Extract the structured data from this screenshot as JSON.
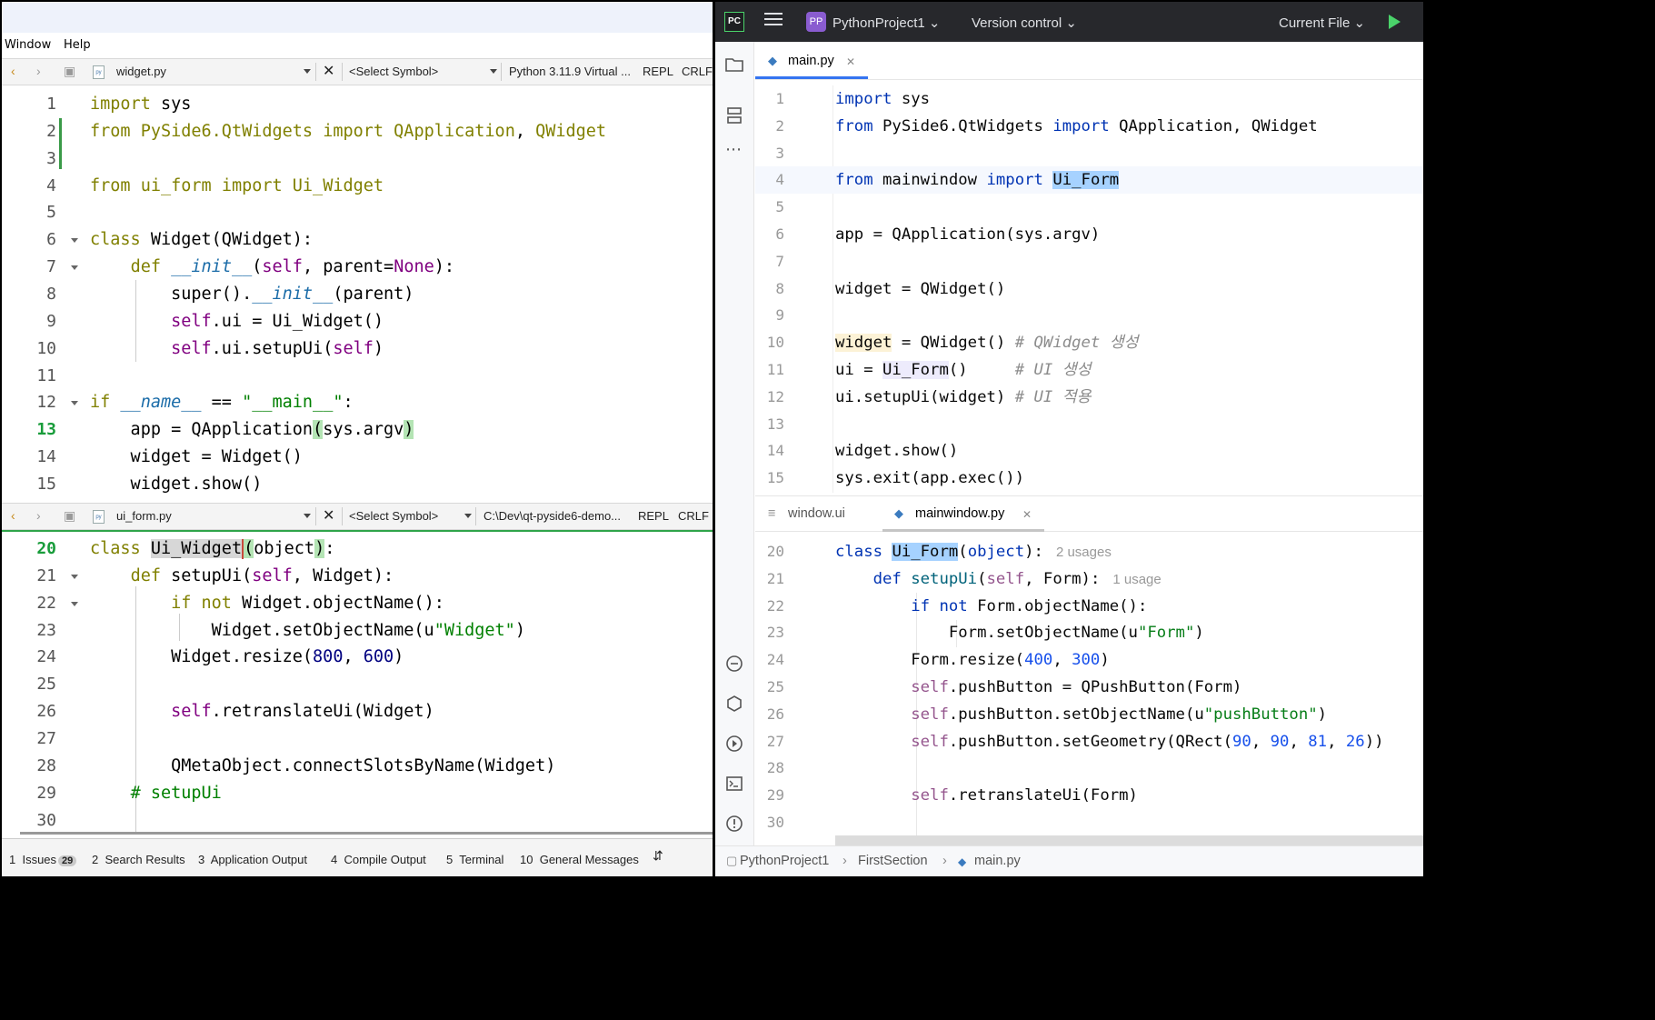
{
  "left": {
    "menu": [
      "Window",
      "Help"
    ],
    "top_toolbar": {
      "file": "widget.py",
      "symbol": "<Select Symbol>",
      "interpreter": "Python 3.11.9 Virtual ...",
      "repl": "REPL",
      "eol": "CRLF"
    },
    "top_code": [
      {
        "n": "1",
        "html": "<span class=\"qk\">import</span> sys"
      },
      {
        "n": "2",
        "html": "<span class=\"qk\">from</span> <span class=\"qk\">PySide6.QtWidgets</span> <span class=\"qk\">import</span> <span class=\"qk\">QApplication</span>, <span class=\"qk\">QWidget</span>"
      },
      {
        "n": "3",
        "html": ""
      },
      {
        "n": "4",
        "html": "<span class=\"qk\">from</span> <span class=\"qk\">ui_form</span> <span class=\"qk\">import</span> <span class=\"qk\">Ui_Widget</span>"
      },
      {
        "n": "5",
        "html": ""
      },
      {
        "n": "6",
        "html": "<span class=\"qk\">class</span> Widget(QWidget):",
        "fold": true
      },
      {
        "n": "7",
        "html": "    <span class=\"qk\">def</span> <span class=\"qf\">__init__</span>(<span class=\"qc\">self</span>, parent=<span class=\"qc\">None</span>):",
        "fold": true
      },
      {
        "n": "8",
        "html": "        super().<span class=\"qf\">__init__</span>(parent)"
      },
      {
        "n": "9",
        "html": "        <span class=\"qc\">self</span>.ui = Ui_Widget()"
      },
      {
        "n": "10",
        "html": "        <span class=\"qc\">self</span>.ui.setupUi(<span class=\"qc\">self</span>)"
      },
      {
        "n": "11",
        "html": ""
      },
      {
        "n": "12",
        "html": "<span class=\"qk\">if</span> <span class=\"qf\">__name__</span> == <span class=\"qs\">\"__main__\"</span>:",
        "fold": true
      },
      {
        "n": "13",
        "html": "    app = QApplication<span class=\"qbr\">(</span>sys.argv<span class=\"qbr\">)</span>",
        "cur": true
      },
      {
        "n": "14",
        "html": "    widget = Widget()"
      },
      {
        "n": "15",
        "html": "    widget.show()"
      }
    ],
    "bottom_toolbar": {
      "file": "ui_form.py",
      "symbol": "<Select Symbol>",
      "path": "C:\\Dev\\qt-pyside6-demo...",
      "repl": "REPL",
      "eol": "CRLF"
    },
    "bottom_code": [
      {
        "n": "20",
        "html": "<span class=\"qk\">class</span> <span class=\"qsel\">Ui_Widget</span><span class=\"qcur\"></span><span class=\"qbr\">(</span>object<span class=\"qbr\">)</span>:",
        "cur": true
      },
      {
        "n": "21",
        "html": "    <span class=\"qk\">def</span> setupUi(<span class=\"qc\">self</span>, Widget):",
        "fold": true
      },
      {
        "n": "22",
        "html": "        <span class=\"qk\">if</span> <span class=\"qk\">not</span> Widget.objectName():",
        "fold": true
      },
      {
        "n": "23",
        "html": "            Widget.setObjectName(u<span class=\"qs\">\"Widget\"</span>)"
      },
      {
        "n": "24",
        "html": "        Widget.resize(<span class=\"qn\">800</span>, <span class=\"qn\">600</span>)"
      },
      {
        "n": "25",
        "html": ""
      },
      {
        "n": "26",
        "html": "        <span class=\"qc\">self</span>.retranslateUi(Widget)"
      },
      {
        "n": "27",
        "html": ""
      },
      {
        "n": "28",
        "html": "        QMetaObject.connectSlotsByName(Widget)"
      },
      {
        "n": "29",
        "html": "    <span class=\"qs\"># setupUi</span>"
      },
      {
        "n": "30",
        "html": ""
      }
    ],
    "output_tabs": [
      {
        "num": "1",
        "label": "Issues",
        "badge": "29"
      },
      {
        "num": "2",
        "label": "Search Results"
      },
      {
        "num": "3",
        "label": "Application Output"
      },
      {
        "num": "4",
        "label": "Compile Output"
      },
      {
        "num": "5",
        "label": "Terminal"
      },
      {
        "num": "10",
        "label": "General Messages"
      }
    ]
  },
  "right": {
    "header": {
      "logo": "PC",
      "project_badge": "PP",
      "project": "PythonProject1",
      "vcs": "Version control",
      "run_config": "Current File"
    },
    "top_tab": "main.py",
    "top_code": [
      {
        "n": "1",
        "html": "<span class=\"pk\">import</span> sys"
      },
      {
        "n": "2",
        "html": "<span class=\"pk\">from</span> PySide6.QtWidgets <span class=\"pk\">import</span> QApplication, QWidget"
      },
      {
        "n": "3",
        "html": ""
      },
      {
        "n": "4",
        "html": "<span class=\"pk\">from</span> mainwindow <span class=\"pk\">import</span> <span class=\"phl\">Ui_Form</span>",
        "cur": true
      },
      {
        "n": "5",
        "html": ""
      },
      {
        "n": "6",
        "html": "app = QApplication(sys.argv)"
      },
      {
        "n": "7",
        "html": ""
      },
      {
        "n": "8",
        "html": "widget = QWidget()"
      },
      {
        "n": "9",
        "html": ""
      },
      {
        "n": "10",
        "html": "<span class=\"pwarn\">widget</span> = QWidget() <span class=\"pcm\"># QWidget 생성</span>"
      },
      {
        "n": "11",
        "html": "ui = <span class=\"phl2\">Ui_Form</span>()     <span class=\"pcm\"># UI 생성</span>"
      },
      {
        "n": "12",
        "html": "ui.setupUi(widget) <span class=\"pcm\"># UI 적용</span>"
      },
      {
        "n": "13",
        "html": ""
      },
      {
        "n": "14",
        "html": "widget.show()"
      },
      {
        "n": "15",
        "html": "sys.exit(app.exec())"
      }
    ],
    "bottom_tabs": [
      "window.ui",
      "mainwindow.py"
    ],
    "bottom_code": [
      {
        "n": "20",
        "html": "<span class=\"pk\">class</span> <span class=\"phl\">Ui_Form</span>(<span class=\"pk\">object</span>):<span class=\"phint\">2 usages</span>"
      },
      {
        "n": "21",
        "html": "    <span class=\"pk\">def</span> <span class=\"pfn\">setupUi</span>(<span class=\"pself\">self</span>, Form):<span class=\"phint\">1 usage</span>"
      },
      {
        "n": "22",
        "html": "        <span class=\"pk\">if</span> <span class=\"pk\">not</span> Form.objectName():"
      },
      {
        "n": "23",
        "html": "            Form.setObjectName(u<span class=\"ps\">\"Form\"</span>)"
      },
      {
        "n": "24",
        "html": "        Form.resize(<span class=\"pn\">400</span>, <span class=\"pn\">300</span>)"
      },
      {
        "n": "25",
        "html": "        <span class=\"pself\">self</span>.pushButton = QPushButton(Form)"
      },
      {
        "n": "26",
        "html": "        <span class=\"pself\">self</span>.pushButton.setObjectName(u<span class=\"ps\">\"pushButton\"</span>)"
      },
      {
        "n": "27",
        "html": "        <span class=\"pself\">self</span>.pushButton.setGeometry(QRect(<span class=\"pn\">90</span>, <span class=\"pn\">90</span>, <span class=\"pn\">81</span>, <span class=\"pn\">26</span>))"
      },
      {
        "n": "28",
        "html": ""
      },
      {
        "n": "29",
        "html": "        <span class=\"pself\">self</span>.retranslateUi(Form)"
      },
      {
        "n": "30",
        "html": ""
      }
    ],
    "breadcrumbs": [
      "PythonProject1",
      "FirstSection",
      "main.py"
    ]
  }
}
